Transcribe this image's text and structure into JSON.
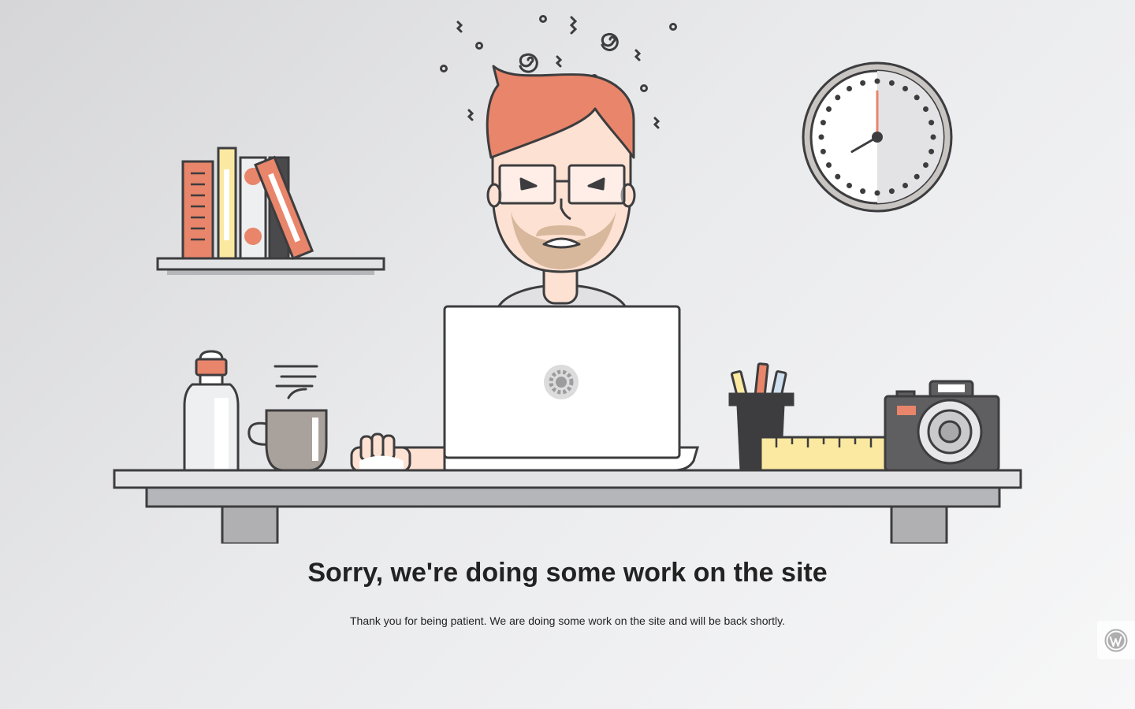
{
  "page": {
    "headline": "Sorry, we're doing some work on the site",
    "message": "Thank you for being patient. We are doing some work on the site and will be back shortly."
  },
  "icons": {
    "laptop_logo": "gear-icon",
    "admin_badge": "wordpress-icon"
  },
  "clock": {
    "hour": 8,
    "minute": 0
  },
  "colors": {
    "accent": "#e8856a",
    "outline": "#3d3d3f",
    "text": "#222222",
    "background": "#e9eaec"
  }
}
